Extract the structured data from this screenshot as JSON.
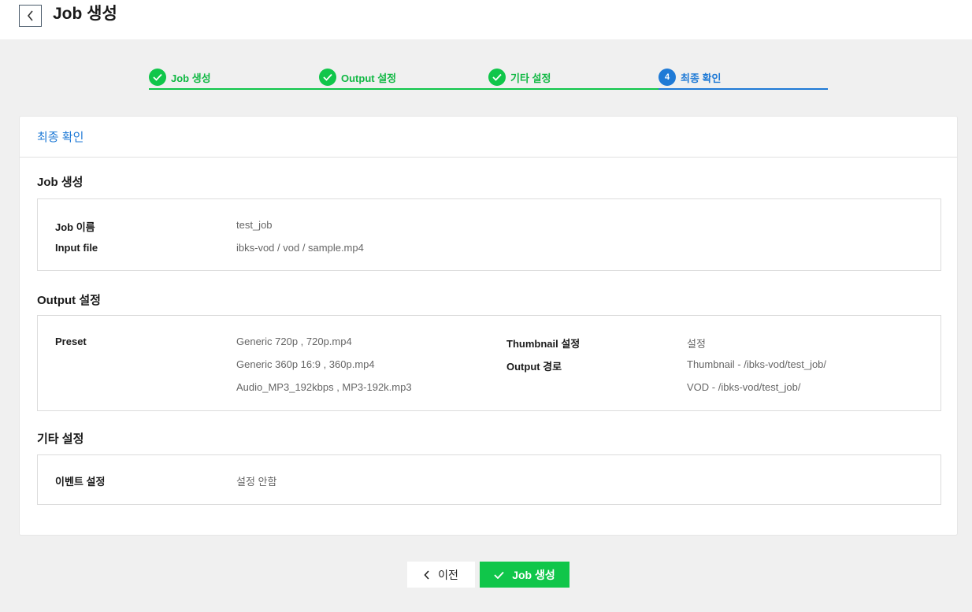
{
  "header": {
    "title": "Job 생성",
    "back_icon": "chevron-left-icon"
  },
  "stepper": {
    "steps": [
      {
        "label": "Job 생성",
        "state": "done"
      },
      {
        "label": "Output 설정",
        "state": "done"
      },
      {
        "label": "기타 설정",
        "state": "done"
      },
      {
        "label": "최종 확인",
        "state": "active",
        "number": "4"
      }
    ]
  },
  "card": {
    "title": "최종 확인",
    "job_section": {
      "title": "Job 생성",
      "job_name_label": "Job 이름",
      "job_name_value": "test_job",
      "input_file_label": "Input file",
      "input_file_value": "ibks-vod / vod / sample.mp4"
    },
    "output_section": {
      "title": "Output 설정",
      "preset_label": "Preset",
      "presets": [
        "Generic 720p , 720p.mp4",
        "Generic 360p 16:9 , 360p.mp4",
        "Audio_MP3_192kbps , MP3-192k.mp3"
      ],
      "thumbnail_label": "Thumbnail 설정",
      "thumbnail_value": "설정",
      "output_path_label": "Output 경로",
      "output_paths": [
        "Thumbnail - /ibks-vod/test_job/",
        "VOD - /ibks-vod/test_job/"
      ]
    },
    "etc_section": {
      "title": "기타 설정",
      "event_label": "이벤트 설정",
      "event_value": "설정 안함"
    }
  },
  "footer": {
    "prev_label": "이전",
    "create_label": "Job 생성"
  },
  "colors": {
    "success": "#10c64a",
    "accent": "#1f7ad6"
  }
}
